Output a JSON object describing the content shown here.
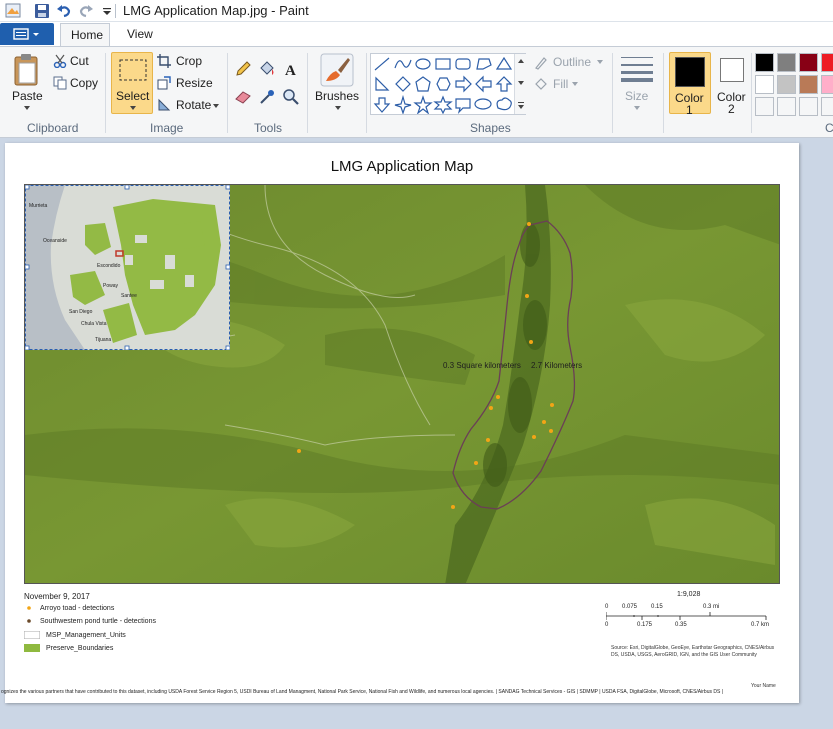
{
  "window": {
    "title": "LMG Application Map.jpg - Paint"
  },
  "tabs": [
    {
      "label": "Home"
    },
    {
      "label": "View"
    }
  ],
  "ribbon": {
    "clipboard": {
      "paste": "Paste",
      "cut": "Cut",
      "copy": "Copy",
      "label": "Clipboard"
    },
    "image": {
      "select": "Select",
      "crop": "Crop",
      "resize": "Resize",
      "rotate": "Rotate",
      "label": "Image"
    },
    "tools": {
      "label": "Tools"
    },
    "brushes": {
      "label": "Brushes"
    },
    "shapes": {
      "outline": "Outline",
      "fill": "Fill",
      "label": "Shapes"
    },
    "size": {
      "label": "Size"
    },
    "color1": {
      "label_a": "Color",
      "label_b": "1"
    },
    "color2": {
      "label_a": "Color",
      "label_b": "2"
    },
    "colors_label": "C",
    "palette_row1": [
      "#000000",
      "#7f7f7f",
      "#880015",
      "#ed1c24"
    ],
    "palette_row2": [
      "#ffffff",
      "#c3c3c3",
      "#b97a57",
      "#ffaec9"
    ],
    "color1_value": "#000000",
    "color2_value": "#ffffff"
  },
  "map": {
    "title": "LMG Application Map",
    "area_label": "0.3 Square kilometers",
    "length_label": "2.7 Kilometers",
    "inset_labels": {
      "escondido": "Escondido",
      "oceanside": "Oceanside",
      "poway": "Poway",
      "santee": "Santee",
      "san_diego": "San Diego",
      "chula_vista": "Chula Vista",
      "tijuana": "Tijuana",
      "murrieta": "Murrieta"
    },
    "date": "November 9, 2017",
    "legend": [
      {
        "label": "Arroyo toad - detections",
        "color": "#f2a516"
      },
      {
        "label": "Southwestern pond turtle - detections",
        "color": "#6b4a2a"
      },
      {
        "label": "MSP_Management_Units",
        "color": "#ffffff"
      },
      {
        "label": "Preserve_Boundaries",
        "color": "#8fb93f"
      }
    ],
    "scale_ratio": "1:9,028",
    "scale_mi": [
      "0",
      "0.075",
      "0.15",
      "0.3 mi"
    ],
    "scale_km": [
      "0",
      "0.175",
      "0.35",
      "0.7 km"
    ],
    "attribution": "Source: Esri, DigitalGlobe, GeoEye, Earthstar Geographics, CNES/Airbus DS, USDA, USGS, AeroGRID, IGN, and the GIS User Community",
    "author": "Your Name",
    "footer": "ognizes the various partners that have contributed to this dataset, including USDA Forest Service Region 5, USDI Bureau of Land Managment, National Park Service, National Fish and Wildlife, and numerous local agencies. | SANDAG Technical Services - GIS | SDMMP | USDA FSA, DigitalGlobe, Microsoft, CNES/Airbus DS |"
  }
}
